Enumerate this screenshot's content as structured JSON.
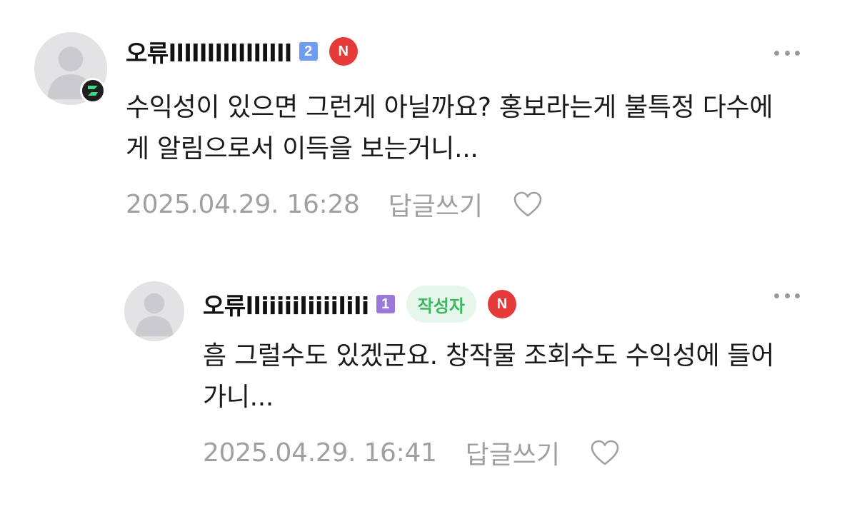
{
  "comments": [
    {
      "nickname": "오류llllllllllllllll",
      "level": "2",
      "level_color": "#6f9cf0",
      "n_badge": "N",
      "avatar_icon": "person-silhouette-icon",
      "platform_icon": "z-logo-icon",
      "text": "수익성이 있으면 그런게 아닐까요? 홍보라는게 불특정 다수에게 알림으로서 이득을 보는거니...",
      "timestamp": "2025.04.29. 16:28",
      "reply_label": "답글쓰기"
    },
    {
      "nickname": "오류lliiiiiliiiilili",
      "level": "1",
      "level_color": "#9b79db",
      "writer_badge": "작성자",
      "n_badge": "N",
      "avatar_icon": "person-silhouette-icon",
      "text": "흠 그럴수도 있겠군요. 창작물 조회수도 수익성에 들어가니...",
      "timestamp": "2025.04.29. 16:41",
      "reply_label": "답글쓰기"
    }
  ],
  "colors": {
    "writer_badge_bg": "#e6f6ea",
    "writer_badge_text": "#3cb861",
    "n_badge": "#e63a3a",
    "meta_text": "#a0a0a0",
    "platform_badge_green": "#3ddc84"
  }
}
